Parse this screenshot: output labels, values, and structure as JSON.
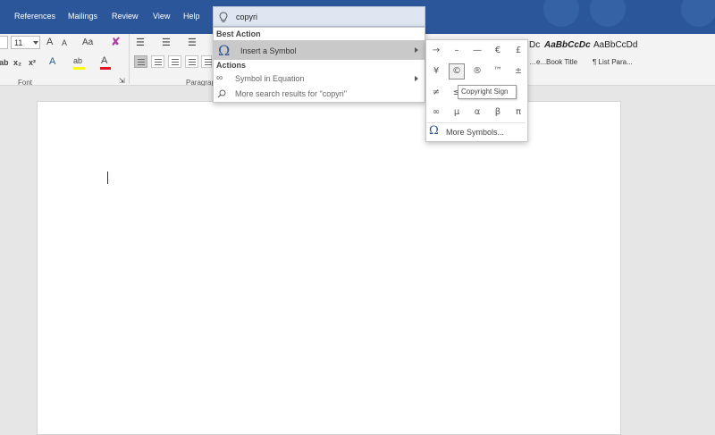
{
  "tabs": [
    "References",
    "Mailings",
    "Review",
    "View",
    "Help"
  ],
  "ribbon": {
    "font_size": "11",
    "font_group_label": "Font",
    "paragraph_group_label": "Paragrap",
    "font_grow": "A",
    "font_shrink": "A",
    "change_case": "Aa",
    "subscript": "x₂",
    "superscript": "x²",
    "font_color": "A",
    "highlight": "ab"
  },
  "styles": [
    {
      "sample": "AaBbCcDc",
      "name": "…e..."
    },
    {
      "sample": "AaBbCcDc",
      "name": "Book Title"
    },
    {
      "sample": "AaBbCcDd",
      "name": "¶ List Para..."
    }
  ],
  "styles_partial_sample": "Dc",
  "search": {
    "value": "copyri"
  },
  "dropdown": {
    "best_action_header": "Best Action",
    "insert_symbol": "Insert a Symbol",
    "actions_header": "Actions",
    "symbol_in_equation": "Symbol in Equation",
    "more_results": "More search results for \"copyri\""
  },
  "symbols": {
    "row1": [
      "→",
      "–",
      "—",
      "€",
      "£"
    ],
    "row2": [
      "¥",
      "©",
      "®",
      "™",
      "±"
    ],
    "row3": [
      "≠",
      "≤"
    ],
    "row4": [
      "∞",
      "µ",
      "α",
      "β",
      "π"
    ],
    "tooltip": "Copyright Sign",
    "more_symbols": "More Symbols..."
  },
  "colors": {
    "tab_bar": "#2b579a",
    "accent": "#2b579a",
    "font_color_bar": "#e81123",
    "highlight_bar": "#ffff00"
  }
}
